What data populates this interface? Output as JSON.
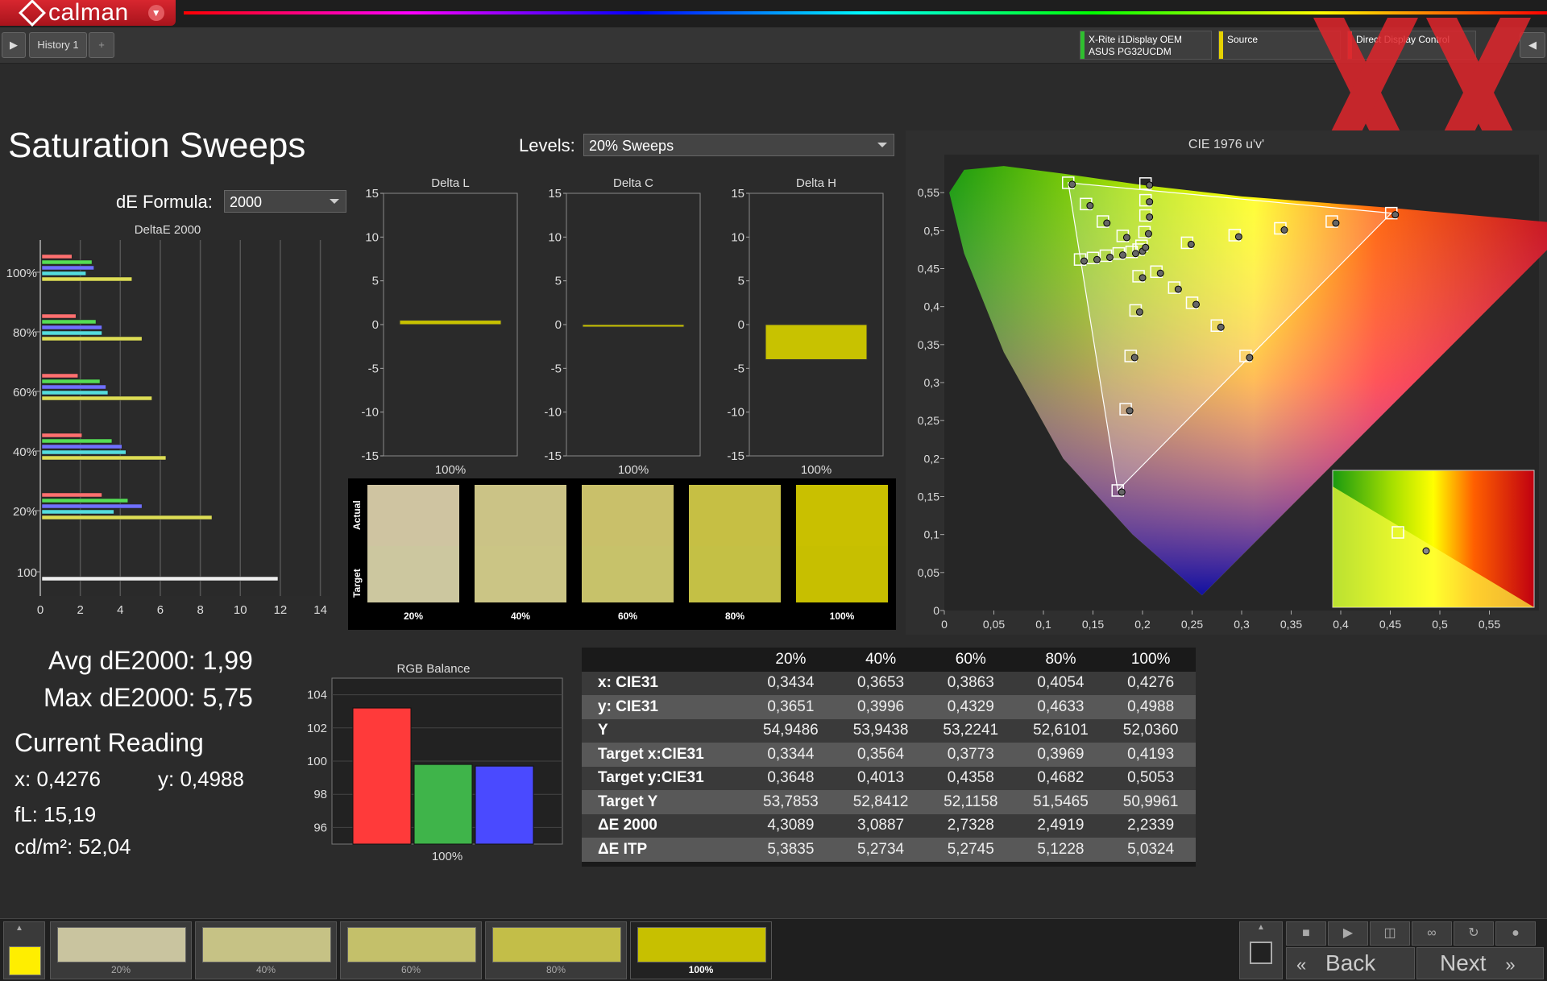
{
  "app": {
    "name": "calman",
    "tab": "History 1"
  },
  "instruments": [
    {
      "line1": "X-Rite i1Display OEM",
      "line2": "ASUS PG32UCDM",
      "color": "#2fbf2f"
    },
    {
      "line1": "Source",
      "line2": "",
      "color": "#e6d200"
    },
    {
      "line1": "Direct Display Control",
      "line2": "",
      "color": "#d04040"
    }
  ],
  "page": {
    "title": "Saturation Sweeps"
  },
  "levels": {
    "label": "Levels:",
    "value": "20% Sweeps"
  },
  "de_formula": {
    "label": "dE Formula:",
    "value": "2000"
  },
  "deltae_chart": {
    "title": "DeltaE 2000",
    "x_ticks": [
      "0",
      "2",
      "4",
      "6",
      "8",
      "10",
      "12",
      "14"
    ],
    "y_labels": [
      "100%",
      "80%",
      "60%",
      "40%",
      "20%",
      "100"
    ],
    "groups": [
      {
        "level": "100%",
        "values": [
          1.5,
          2.5,
          2.6,
          2.2,
          4.5
        ]
      },
      {
        "level": "80%",
        "values": [
          1.7,
          2.7,
          3.0,
          3.0,
          5.0
        ]
      },
      {
        "level": "60%",
        "values": [
          1.8,
          2.9,
          3.2,
          3.3,
          5.5
        ]
      },
      {
        "level": "40%",
        "values": [
          2.0,
          3.5,
          4.0,
          4.2,
          6.2
        ]
      },
      {
        "level": "20%",
        "values": [
          3.0,
          4.3,
          5.0,
          3.6,
          8.5
        ]
      },
      {
        "level": "100",
        "values": [
          11.8
        ]
      }
    ],
    "colors": [
      "#ff7070",
      "#55dd55",
      "#7070ff",
      "#55dddd",
      "#dddd55"
    ]
  },
  "delta_charts": [
    {
      "title": "Delta L",
      "value": 0.5,
      "xlabel": "100%"
    },
    {
      "title": "Delta C",
      "value": -0.2,
      "xlabel": "100%"
    },
    {
      "title": "Delta H",
      "value": -4.0,
      "xlabel": "100%"
    }
  ],
  "delta_ticks": [
    "15",
    "10",
    "5",
    "0",
    "-5",
    "-10",
    "-15"
  ],
  "swatches": {
    "actual_label": "Actual",
    "target_label": "Target",
    "items": [
      {
        "label": "20%",
        "actual": "#cfc4a1",
        "target": "#ccc79f"
      },
      {
        "label": "40%",
        "actual": "#cbc386",
        "target": "#cbc585"
      },
      {
        "label": "60%",
        "actual": "#c9c06a",
        "target": "#c7c26a"
      },
      {
        "label": "80%",
        "actual": "#c6bf44",
        "target": "#c4c045"
      },
      {
        "label": "100%",
        "actual": "#c9c000",
        "target": "#c7bf00"
      }
    ]
  },
  "cie": {
    "title": "CIE 1976 u'v'",
    "x_ticks": [
      "0",
      "0,05",
      "0,1",
      "0,15",
      "0,2",
      "0,25",
      "0,3",
      "0,35",
      "0,4",
      "0,45",
      "0,5",
      "0,55"
    ],
    "y_ticks": [
      "0",
      "0,05",
      "0,1",
      "0,15",
      "0,2",
      "0,25",
      "0,3",
      "0,35",
      "0,4",
      "0,45",
      "0,5",
      "0,55"
    ]
  },
  "summary": {
    "avg": "Avg dE2000: 1,99",
    "max": "Max dE2000: 5,75",
    "current_reading": "Current Reading",
    "x": "x: 0,4276",
    "y": "y: 0,4988",
    "fl": "fL: 15,19",
    "cdm": "cd/m²: 52,04"
  },
  "rgb_balance": {
    "title": "RGB Balance",
    "y_ticks": [
      "104",
      "102",
      "100",
      "98",
      "96"
    ],
    "xlabel": "100%",
    "values": [
      103.2,
      99.8,
      99.7
    ],
    "colors": [
      "#ff3a3a",
      "#3fb44a",
      "#4a4aff"
    ]
  },
  "table": {
    "headers": [
      "",
      "20%",
      "40%",
      "60%",
      "80%",
      "100%"
    ],
    "rows": [
      [
        "x: CIE31",
        "0,3434",
        "0,3653",
        "0,3863",
        "0,4054",
        "0,4276"
      ],
      [
        "y: CIE31",
        "0,3651",
        "0,3996",
        "0,4329",
        "0,4633",
        "0,4988"
      ],
      [
        "Y",
        "54,9486",
        "53,9438",
        "53,2241",
        "52,6101",
        "52,0360"
      ],
      [
        "Target x:CIE31",
        "0,3344",
        "0,3564",
        "0,3773",
        "0,3969",
        "0,4193"
      ],
      [
        "Target y:CIE31",
        "0,3648",
        "0,4013",
        "0,4358",
        "0,4682",
        "0,5053"
      ],
      [
        "Target Y",
        "53,7853",
        "52,8412",
        "52,1158",
        "51,5465",
        "50,9961"
      ],
      [
        "ΔE 2000",
        "4,3089",
        "3,0887",
        "2,7328",
        "2,4919",
        "2,2339"
      ],
      [
        "ΔE ITP",
        "5,3835",
        "5,2734",
        "5,2745",
        "5,1228",
        "5,0324"
      ]
    ]
  },
  "bottom": {
    "current_color": "#ffee00",
    "tiles": [
      {
        "label": "20%",
        "color": "#c9c49f"
      },
      {
        "label": "40%",
        "color": "#c6c285"
      },
      {
        "label": "60%",
        "color": "#c4c06a"
      },
      {
        "label": "80%",
        "color": "#c3be48"
      },
      {
        "label": "100%",
        "color": "#c7c000"
      }
    ],
    "back": "Back",
    "next": "Next"
  }
}
